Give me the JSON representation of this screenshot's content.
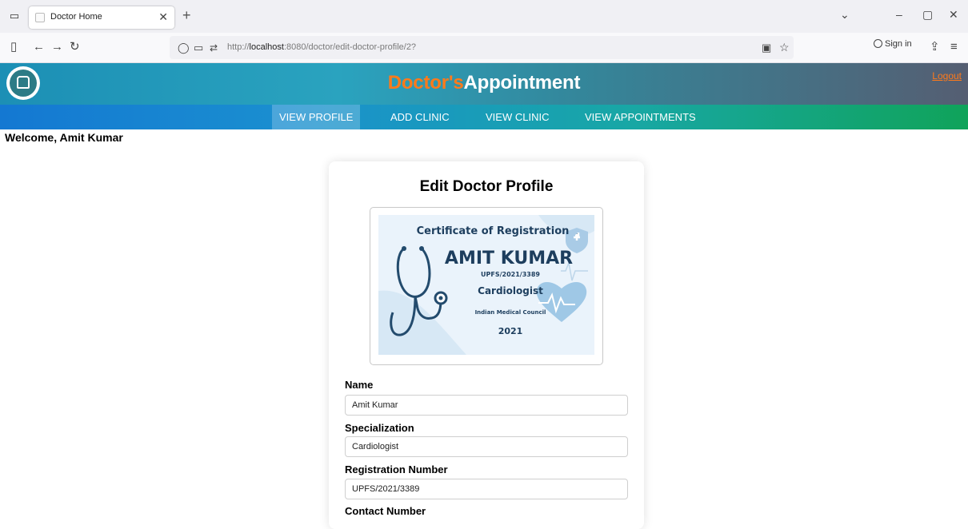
{
  "browser": {
    "tab_title": "Doctor Home",
    "url_prefix": "http://",
    "url_host": "localhost",
    "url_rest": ":8080/doctor/edit-doctor-profile/2?",
    "sign_in": "Sign in"
  },
  "header": {
    "brand_part1": "Doctor's",
    "brand_part2": "Appointment",
    "logout": "Logout"
  },
  "nav": {
    "items": [
      {
        "label": "VIEW PROFILE",
        "active": true
      },
      {
        "label": "ADD CLINIC"
      },
      {
        "label": "VIEW CLINIC"
      },
      {
        "label": "VIEW APPOINTMENTS"
      }
    ]
  },
  "welcome": "Welcome, Amit Kumar",
  "form": {
    "title": "Edit Doctor Profile",
    "certificate": {
      "heading": "Certificate of Registration",
      "name": "AMIT KUMAR",
      "reg_no": "UPFS/2021/3389",
      "specialty": "Cardiologist",
      "council": "Indian Medical Council",
      "year": "2021"
    },
    "fields": [
      {
        "label": "Name",
        "value": "Amit Kumar"
      },
      {
        "label": "Specialization",
        "value": "Cardiologist"
      },
      {
        "label": "Registration Number",
        "value": "UPFS/2021/3389"
      },
      {
        "label": "Contact Number",
        "value": ""
      }
    ]
  },
  "colors": {
    "accent_orange": "#ff7a1a",
    "cert_text": "#1d3e5e"
  }
}
